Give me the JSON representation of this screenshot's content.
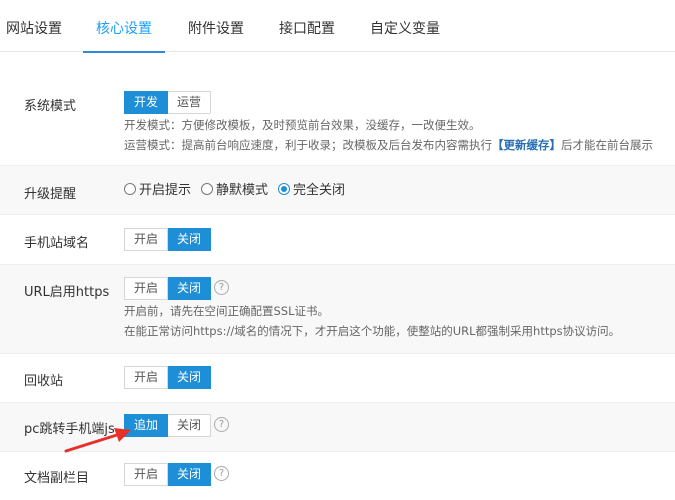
{
  "tabs": [
    {
      "label": "网站设置"
    },
    {
      "label": "核心设置"
    },
    {
      "label": "附件设置"
    },
    {
      "label": "接口配置"
    },
    {
      "label": "自定义变量"
    }
  ],
  "settings": {
    "system_mode": {
      "label": "系统模式",
      "options": [
        "开发",
        "运营"
      ],
      "selected": "开发",
      "note1": "开发模式：方便修改模板，及时预览前台效果，没缓存，一改便生效。",
      "note2_prefix": "运营模式：提高前台响应速度，利于收录；改模板及后台发布内容需执行",
      "note2_highlight": "【更新缓存】",
      "note2_suffix": "后才能在前台展示"
    },
    "upgrade_prompt": {
      "label": "升级提醒",
      "options": [
        "开启提示",
        "静默模式",
        "完全关闭"
      ],
      "selected": "完全关闭"
    },
    "mobile_domain": {
      "label": "手机站域名",
      "options": [
        "开启",
        "关闭"
      ],
      "selected": "关闭"
    },
    "url_https": {
      "label": "URL启用https",
      "options": [
        "开启",
        "关闭"
      ],
      "selected": "关闭",
      "note1": "开启前，请先在空间正确配置SSL证书。",
      "note2": "在能正常访问https://域名的情况下，才开启这个功能，使整站的URL都强制采用https协议访问。"
    },
    "recycle_bin": {
      "label": "回收站",
      "options": [
        "开启",
        "关闭"
      ],
      "selected": "关闭"
    },
    "pc_jump_mobile": {
      "label": "pc跳转手机端js",
      "options": [
        "追加",
        "关闭"
      ],
      "selected": "追加"
    },
    "doc_sub_column": {
      "label": "文档副栏目",
      "options": [
        "开启",
        "关闭"
      ],
      "selected": "关闭"
    }
  },
  "help_glyph": "?",
  "icons": {
    "help": "question-circle-icon",
    "arrow": "red-arrow-annotation"
  },
  "colors": {
    "accent": "#1e8fd6",
    "tab_active": "#1e9fff",
    "arrow": "#e8302a"
  }
}
